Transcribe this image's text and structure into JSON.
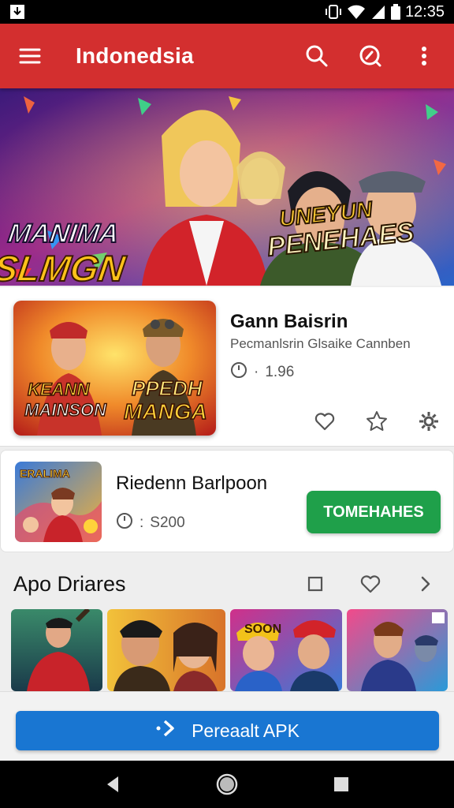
{
  "status_bar": {
    "time": "12:35"
  },
  "app_bar": {
    "title": "Indonedsia"
  },
  "banner": {
    "left_line1": "MANIMA",
    "left_line2": "SLMGN",
    "right_line1": "UNEYUN",
    "right_line2": "PENEHAES"
  },
  "featured": {
    "thumb_line1": "KEANN",
    "thumb_line2": "MAINSON",
    "thumb_line3": "PPEDH",
    "thumb_line4": "MANGA",
    "title": "Gann Baisrin",
    "subtitle": "Pecmanlsrin Glsaike Cannben",
    "meta": "1.96"
  },
  "second": {
    "thumb_label": "ERALIMA",
    "name": "Riedenn Barlpoon",
    "price": "S200",
    "button_label": "TOMEHAHES"
  },
  "section": {
    "title": "Apo Driares",
    "tile2_label": "SOON"
  },
  "install": {
    "label": "Pereaalt APK"
  },
  "colors": {
    "app_bar": "#d32f2f",
    "install_button": "#1976d2",
    "get_button": "#1fa04a"
  }
}
